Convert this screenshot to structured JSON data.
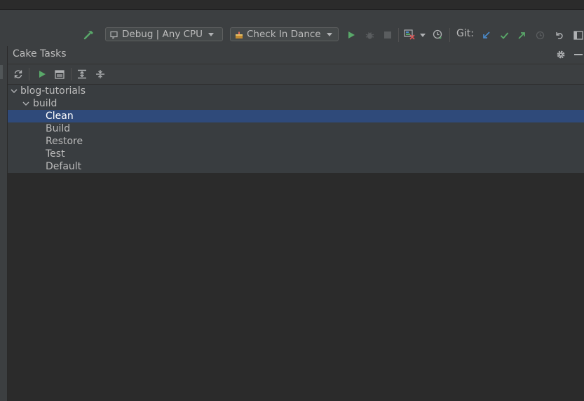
{
  "toolbar": {
    "build_icon": "hammer-icon",
    "config_combo": {
      "icon": "window-config-icon",
      "label": "Debug | Any CPU"
    },
    "run_combo": {
      "icon": "cake-icon",
      "label": "Check In Dance"
    },
    "actions": [
      "run-icon",
      "debug-bug-icon",
      "stop-icon",
      "coverage-icon",
      "dropdown-icon",
      "profiler-icon"
    ],
    "git": {
      "label": "Git:",
      "icons": [
        "update-arrow-icon",
        "commit-check-icon",
        "push-arrow-icon",
        "history-clock-icon",
        "rollback-icon",
        "window-icon"
      ]
    }
  },
  "panel": {
    "title": "Cake Tasks",
    "header_icons": [
      "gear-icon",
      "minimize-icon"
    ],
    "toolbar_icons": [
      "refresh-icon",
      "run-task-icon",
      "window-icon",
      "expand-all-icon",
      "collapse-all-icon"
    ]
  },
  "tree": {
    "root": "blog-tutorials",
    "folder": "build",
    "tasks": [
      "Clean",
      "Build",
      "Restore",
      "Test",
      "Default"
    ],
    "selected": "Clean"
  },
  "colors": {
    "background": "#2b2b2b",
    "toolbar": "#3c3f41",
    "selection": "#2f4a7a",
    "accent_green": "#59a869",
    "accent_blue": "#4a88c7"
  }
}
